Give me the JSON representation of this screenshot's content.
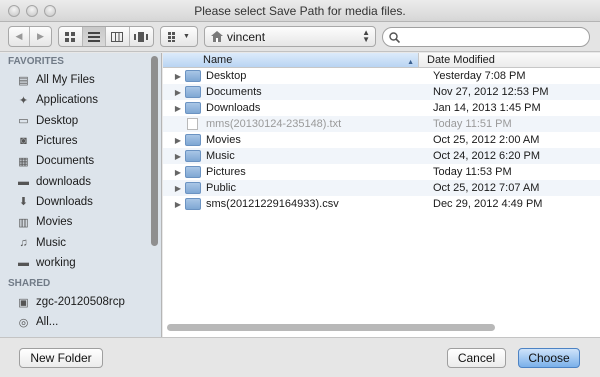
{
  "window": {
    "title": "Please select Save Path for media files."
  },
  "toolbar": {
    "back_icon": "chevron-left-icon",
    "forward_icon": "chevron-right-icon",
    "view_modes": [
      "icon-view",
      "list-view",
      "column-view",
      "coverflow-view"
    ],
    "arrange_icon": "arrange-grid-icon",
    "path_label": "vincent",
    "search_placeholder": ""
  },
  "sidebar": {
    "favorites_header": "FAVORITES",
    "favorites": [
      {
        "label": "All My Files",
        "icon": "all-files-icon"
      },
      {
        "label": "Applications",
        "icon": "applications-icon"
      },
      {
        "label": "Desktop",
        "icon": "desktop-icon"
      },
      {
        "label": "Pictures",
        "icon": "camera-icon"
      },
      {
        "label": "Documents",
        "icon": "documents-icon"
      },
      {
        "label": "downloads",
        "icon": "folder-icon"
      },
      {
        "label": "Downloads",
        "icon": "download-icon"
      },
      {
        "label": "Movies",
        "icon": "film-icon"
      },
      {
        "label": "Music",
        "icon": "music-icon"
      },
      {
        "label": "working",
        "icon": "folder-icon"
      }
    ],
    "shared_header": "SHARED",
    "shared": [
      {
        "label": "zgc-20120508rcp",
        "icon": "computer-icon"
      },
      {
        "label": "All...",
        "icon": "network-icon"
      }
    ]
  },
  "files": {
    "columns": [
      "Name",
      "Date Modified"
    ],
    "rows": [
      {
        "name": "Desktop",
        "date": "Yesterday 7:08 PM",
        "type": "folder",
        "expandable": true,
        "enabled": true
      },
      {
        "name": "Documents",
        "date": "Nov 27, 2012 12:53 PM",
        "type": "folder",
        "expandable": true,
        "enabled": true
      },
      {
        "name": "Downloads",
        "date": "Jan 14, 2013 1:45 PM",
        "type": "folder",
        "expandable": true,
        "enabled": true
      },
      {
        "name": "mms(20130124-235148).txt",
        "date": "Today 11:51 PM",
        "type": "file",
        "expandable": false,
        "enabled": false
      },
      {
        "name": "Movies",
        "date": "Oct 25, 2012 2:00 AM",
        "type": "folder",
        "expandable": true,
        "enabled": true
      },
      {
        "name": "Music",
        "date": "Oct 24, 2012 6:20 PM",
        "type": "folder",
        "expandable": true,
        "enabled": true
      },
      {
        "name": "Pictures",
        "date": "Today 11:53 PM",
        "type": "folder",
        "expandable": true,
        "enabled": true
      },
      {
        "name": "Public",
        "date": "Oct 25, 2012 7:07 AM",
        "type": "folder",
        "expandable": true,
        "enabled": true
      },
      {
        "name": "sms(20121229164933).csv",
        "date": "Dec 29, 2012 4:49 PM",
        "type": "folder",
        "expandable": true,
        "enabled": true
      }
    ]
  },
  "buttons": {
    "new_folder": "New Folder",
    "cancel": "Cancel",
    "choose": "Choose"
  }
}
